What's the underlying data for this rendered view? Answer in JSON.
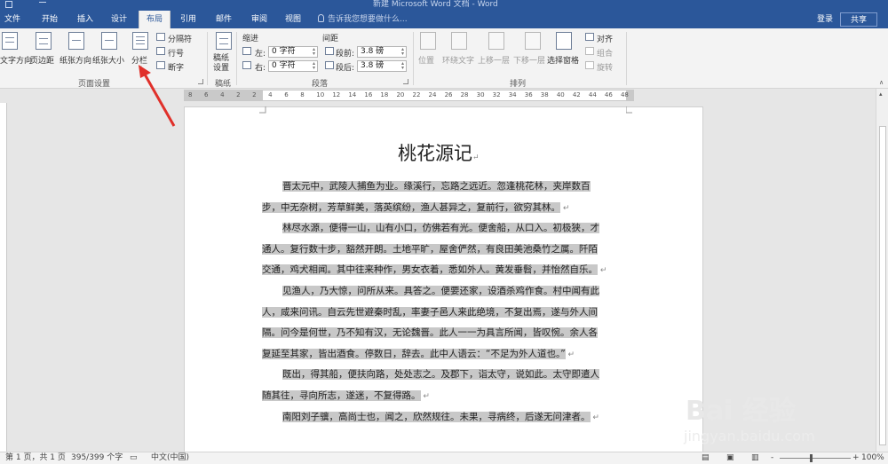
{
  "window": {
    "title": "新建 Microsoft Word 文档 - Word"
  },
  "menu": {
    "tabs": [
      "文件",
      "开始",
      "插入",
      "设计",
      "布局",
      "引用",
      "邮件",
      "审阅",
      "视图"
    ],
    "active": "布局",
    "tell_me": "告诉我您想要做什么...",
    "login": "登录",
    "share": "共享"
  },
  "ribbon": {
    "page_setup": {
      "text_direction": "文字方向",
      "margins": "页边距",
      "orientation": "纸张方向",
      "size": "纸张大小",
      "columns": "分栏",
      "breaks": "分隔符",
      "line_numbers": "行号",
      "hyphenation": "断字",
      "group_label": "页面设置"
    },
    "draft": {
      "button": "稿纸\n设置",
      "group_label": "稿纸"
    },
    "paragraph": {
      "indent_label": "缩进",
      "spacing_label": "间距",
      "left_label": "左:",
      "right_label": "右:",
      "before_label": "段前:",
      "after_label": "段后:",
      "indent_left": "0 字符",
      "indent_right": "0 字符",
      "space_before": "3.8 磅",
      "space_after": "3.8 磅",
      "group_label": "段落"
    },
    "arrange": {
      "position": "位置",
      "wrap_text": "环绕文字",
      "bring_forward": "上移一层",
      "send_backward": "下移一层",
      "selection_pane": "选择窗格",
      "align": "对齐",
      "group": "组合",
      "rotate": "旋转",
      "group_label": "排列"
    }
  },
  "ruler": {
    "numbers": [
      "8",
      "6",
      "4",
      "2",
      "2",
      "4",
      "6",
      "8",
      "10",
      "12",
      "14",
      "16",
      "18",
      "20",
      "22",
      "24",
      "26",
      "28",
      "30",
      "32",
      "34",
      "36",
      "38",
      "40",
      "42",
      "44",
      "46",
      "48"
    ]
  },
  "document": {
    "title": "桃花源记",
    "paragraphs": [
      [
        "晋太元中，武陵人捕鱼为业。缘溪行，忘路之远近。忽逢桃花林，夹岸数百",
        "步，中无杂树，芳草鲜美，落英缤纷，渔人甚异之，复前行，欲穷其林。"
      ],
      [
        "林尽水源，便得一山，山有小口，仿佛若有光。便舍船，从口入。初极狭，才",
        "通人。复行数十步，豁然开朗。土地平旷，屋舍俨然，有良田美池桑竹之属。阡陌",
        "交通，鸡犬相闻。其中往来种作，男女衣着，悉如外人。黄发垂髫，并怡然自乐。"
      ],
      [
        "见渔人，乃大惊，问所从来。具答之。便要还家，设酒杀鸡作食。村中闻有此",
        "人，咸来问讯。自云先世避秦时乱，率妻子邑人来此绝境，不复出焉，遂与外人间",
        "隔。问今是何世，乃不知有汉，无论魏晋。此人一一为具言所闻，皆叹惋。余人各",
        "复延至其家，皆出酒食。停数日，辞去。此中人语云：“不足为外人道也。”"
      ],
      [
        "既出，得其船，便扶向路，处处志之。及郡下，诣太守，说如此。太守即遣人",
        "随其往，寻向所志，遂迷，不复得路。"
      ],
      [
        "南阳刘子骥，高尚士也，闻之，欣然规往。未果，寻病终，后遂无问津者。"
      ]
    ]
  },
  "status": {
    "page": "第 1 页，共 1 页",
    "words": "395/399 个字",
    "language": "中文(中国)",
    "zoom": "100%",
    "zoom_minus": "-",
    "zoom_plus": "+"
  },
  "watermark": {
    "brand": "Bai 经验",
    "url": "jingyan.baidu.com"
  }
}
